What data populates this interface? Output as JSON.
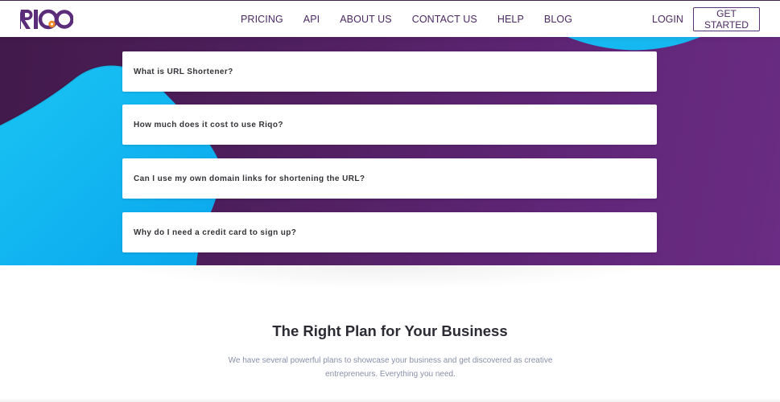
{
  "header": {
    "logo_text": "RIQO",
    "nav": [
      "PRICING",
      "API",
      "ABOUT US",
      "CONTACT US",
      "HELP",
      "BLOG"
    ],
    "login_label": "LOGIN",
    "cta_label": "GET STARTED"
  },
  "faq": {
    "items": [
      "What is URL Shortener?",
      "How much does it cost to use Riqo?",
      "Can I use my own domain links for shortening the URL?",
      "Why do I need a credit card to sign up?"
    ]
  },
  "plans": {
    "title": "The Right Plan for Your Business",
    "description": "We have several powerful plans to showcase your business and get discovered as creative entrepreneurs. Everything you need."
  },
  "colors": {
    "brand_purple": "#4b2a63",
    "logo_orange": "#f08a24",
    "band_purple": "#5a2470",
    "blob_cyan": "#12b5f0"
  }
}
